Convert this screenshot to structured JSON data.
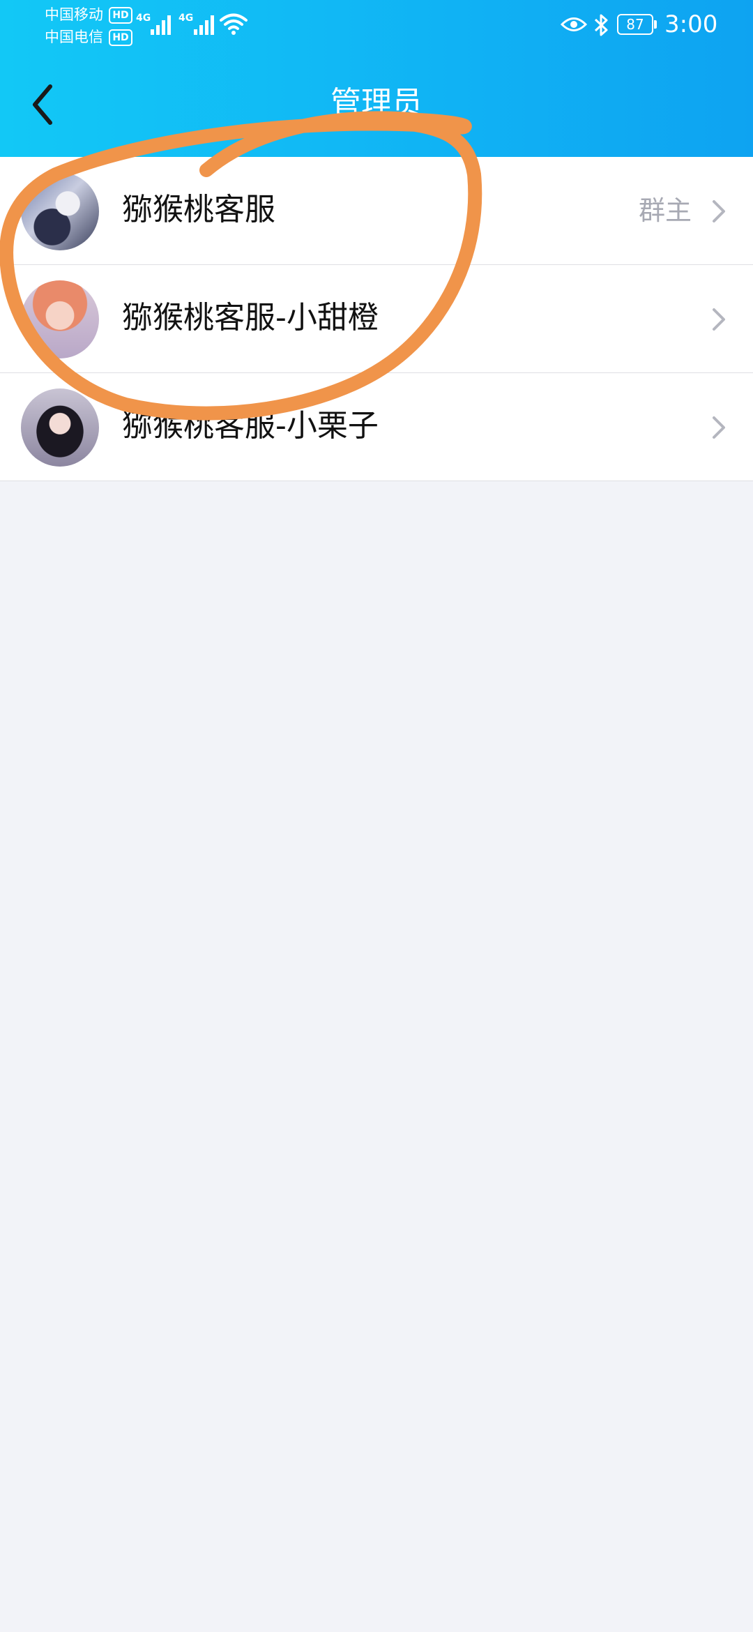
{
  "status_bar": {
    "carrier_1": "中国移动",
    "carrier_2": "中国电信",
    "hd_badge": "HD",
    "network_1": "4G",
    "network_2": "4G",
    "battery": "87",
    "time": "3:00",
    "icons": [
      "signal-icon",
      "wifi-icon",
      "eye-icon",
      "bluetooth-icon",
      "battery-icon"
    ]
  },
  "header": {
    "title": "管理员",
    "back_icon": "chevron-left-icon",
    "gradient_colors": [
      "#12c8f6",
      "#0ea3f1"
    ]
  },
  "admins": [
    {
      "name": "猕猴桃客服",
      "role": "群主"
    },
    {
      "name": "猕猴桃客服-小甜橙",
      "role": ""
    },
    {
      "name": "猕猴桃客服-小栗子",
      "role": ""
    }
  ],
  "colors": {
    "background": "#f2f3f8",
    "annotation_stroke": "#f0944a",
    "role_text": "#a7a9b3",
    "chevron": "#b4b6bf"
  }
}
